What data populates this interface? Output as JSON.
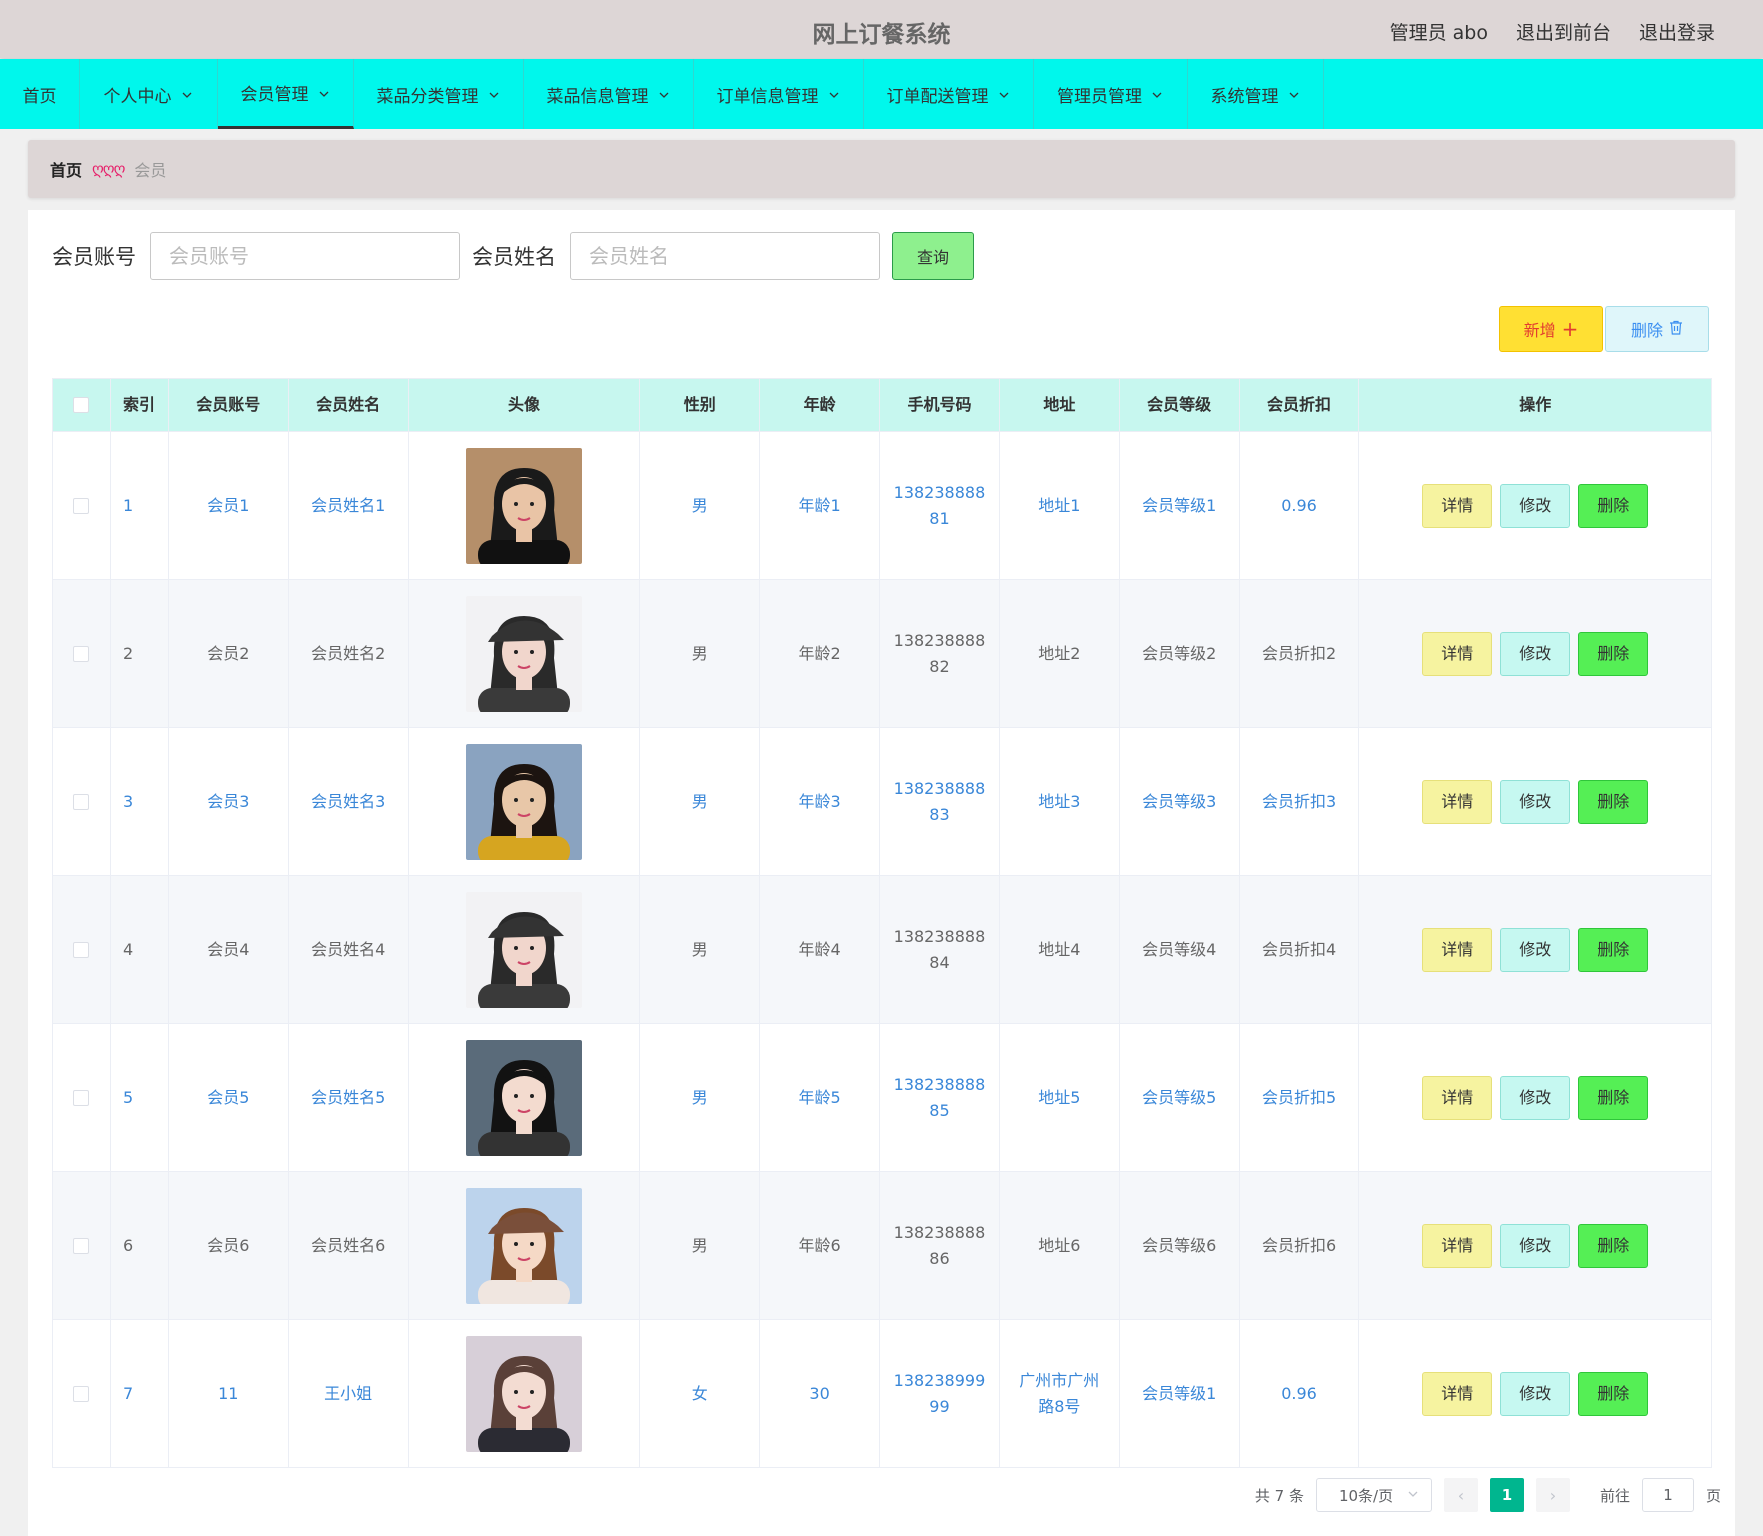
{
  "header": {
    "title": "网上订餐系统",
    "admin": "管理员 abo",
    "to_front": "退出到前台",
    "logout": "退出登录"
  },
  "nav": [
    {
      "label": "首页",
      "has_menu": false
    },
    {
      "label": "个人中心",
      "has_menu": true
    },
    {
      "label": "会员管理",
      "has_menu": true,
      "active": true
    },
    {
      "label": "菜品分类管理",
      "has_menu": true
    },
    {
      "label": "菜品信息管理",
      "has_menu": true
    },
    {
      "label": "订单信息管理",
      "has_menu": true
    },
    {
      "label": "订单配送管理",
      "has_menu": true
    },
    {
      "label": "管理员管理",
      "has_menu": true
    },
    {
      "label": "系统管理",
      "has_menu": true
    }
  ],
  "breadcrumb": {
    "home": "首页",
    "separator": "ღღღ",
    "current": "会员"
  },
  "search": {
    "account_label": "会员账号",
    "account_placeholder": "会员账号",
    "name_label": "会员姓名",
    "name_placeholder": "会员姓名",
    "query_label": "查询"
  },
  "toolbar": {
    "add_label": "新增",
    "add_icon": "+",
    "delete_label": "删除"
  },
  "table": {
    "headers": [
      "索引",
      "会员账号",
      "会员姓名",
      "头像",
      "性别",
      "年龄",
      "手机号码",
      "地址",
      "会员等级",
      "会员折扣",
      "操作"
    ],
    "rows": [
      {
        "idx": "1",
        "account": "会员1",
        "name": "会员姓名1",
        "avatar": "avatar-1",
        "sex": "男",
        "age": "年龄1",
        "phone": "13823888881",
        "addr": "地址1",
        "level": "会员等级1",
        "discount": "0.96"
      },
      {
        "idx": "2",
        "account": "会员2",
        "name": "会员姓名2",
        "avatar": "avatar-2",
        "sex": "男",
        "age": "年龄2",
        "phone": "13823888882",
        "addr": "地址2",
        "level": "会员等级2",
        "discount": "会员折扣2"
      },
      {
        "idx": "3",
        "account": "会员3",
        "name": "会员姓名3",
        "avatar": "avatar-3",
        "sex": "男",
        "age": "年龄3",
        "phone": "13823888883",
        "addr": "地址3",
        "level": "会员等级3",
        "discount": "会员折扣3"
      },
      {
        "idx": "4",
        "account": "会员4",
        "name": "会员姓名4",
        "avatar": "avatar-2",
        "sex": "男",
        "age": "年龄4",
        "phone": "13823888884",
        "addr": "地址4",
        "level": "会员等级4",
        "discount": "会员折扣4"
      },
      {
        "idx": "5",
        "account": "会员5",
        "name": "会员姓名5",
        "avatar": "avatar-5",
        "sex": "男",
        "age": "年龄5",
        "phone": "13823888885",
        "addr": "地址5",
        "level": "会员等级5",
        "discount": "会员折扣5"
      },
      {
        "idx": "6",
        "account": "会员6",
        "name": "会员姓名6",
        "avatar": "avatar-6",
        "sex": "男",
        "age": "年龄6",
        "phone": "13823888886",
        "addr": "地址6",
        "level": "会员等级6",
        "discount": "会员折扣6"
      },
      {
        "idx": "7",
        "account": "11",
        "name": "王小姐",
        "avatar": "avatar-7",
        "sex": "女",
        "age": "30",
        "phone": "13823899999",
        "addr": "广州市广州路8号",
        "level": "会员等级1",
        "discount": "0.96"
      }
    ],
    "op_detail": "详情",
    "op_edit": "修改",
    "op_delete": "删除"
  },
  "pager": {
    "total": "共 7 条",
    "page_size": "10条/页",
    "current": "1",
    "goto_label": "前往",
    "goto_value": "1",
    "page_unit": "页"
  },
  "colors": {
    "nav_bg": "#00f7ec",
    "header_bg": "#ddd6d6",
    "table_head_bg": "#c7f7ef",
    "link_blue": "#3a87d8",
    "pager_active": "#00b68f"
  }
}
